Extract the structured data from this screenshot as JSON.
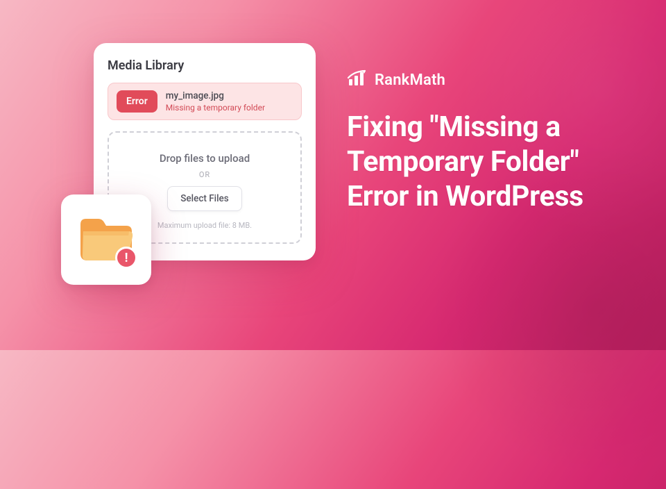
{
  "brand": {
    "name": "RankMath"
  },
  "headline": "Fixing \"Missing a Temporary Folder\" Error in WordPress",
  "card": {
    "title": "Media Library",
    "error": {
      "badge": "Error",
      "filename": "my_image.jpg",
      "message": "Missing a temporary folder"
    },
    "dropzone": {
      "label": "Drop files to upload",
      "or": "OR",
      "button": "Select Files",
      "maxnote": "Maximum upload file: 8 MB."
    }
  },
  "icons": {
    "folder_alert": "!"
  }
}
